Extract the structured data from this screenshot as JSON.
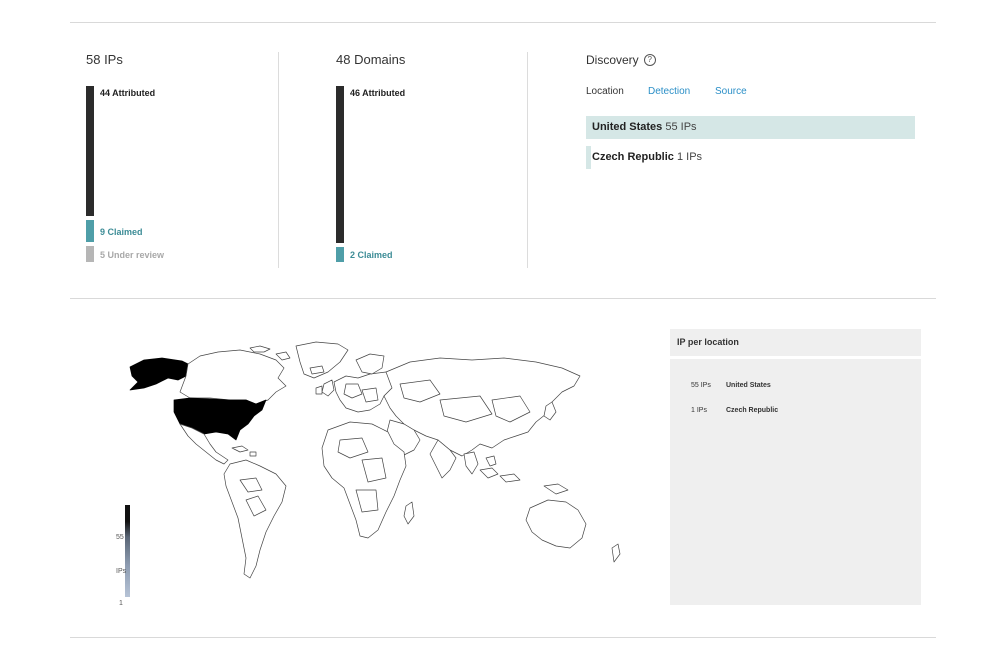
{
  "ips": {
    "title": "58 IPs",
    "attributed": "44 Attributed",
    "claimed": "9 Claimed",
    "under_review": "5 Under review"
  },
  "domains": {
    "title": "48 Domains",
    "attributed": "46 Attributed",
    "claimed": "2 Claimed"
  },
  "discovery": {
    "title": "Discovery",
    "tabs": [
      "Location",
      "Detection",
      "Source"
    ],
    "rows": [
      {
        "country": "United States",
        "count": "55 IPs",
        "share": 1.0
      },
      {
        "country": "Czech Republic",
        "count": "1 IPs",
        "share": 0.018
      }
    ]
  },
  "map": {
    "highlight_color": "#000000",
    "legend": {
      "max": "55",
      "unit": "IPs",
      "min": "1"
    }
  },
  "ip_per_location": {
    "title": "IP per location",
    "rows": [
      {
        "count": "55 IPs",
        "country": "United States"
      },
      {
        "count": "1 IPs",
        "country": "Czech Republic"
      }
    ]
  },
  "colors": {
    "bar_dark": "#2b2b2b",
    "bar_teal": "#4f9ea8",
    "bar_gray": "#b6b6b6",
    "link": "#2b8fc7",
    "highlight_row": "#d5e7e6"
  }
}
